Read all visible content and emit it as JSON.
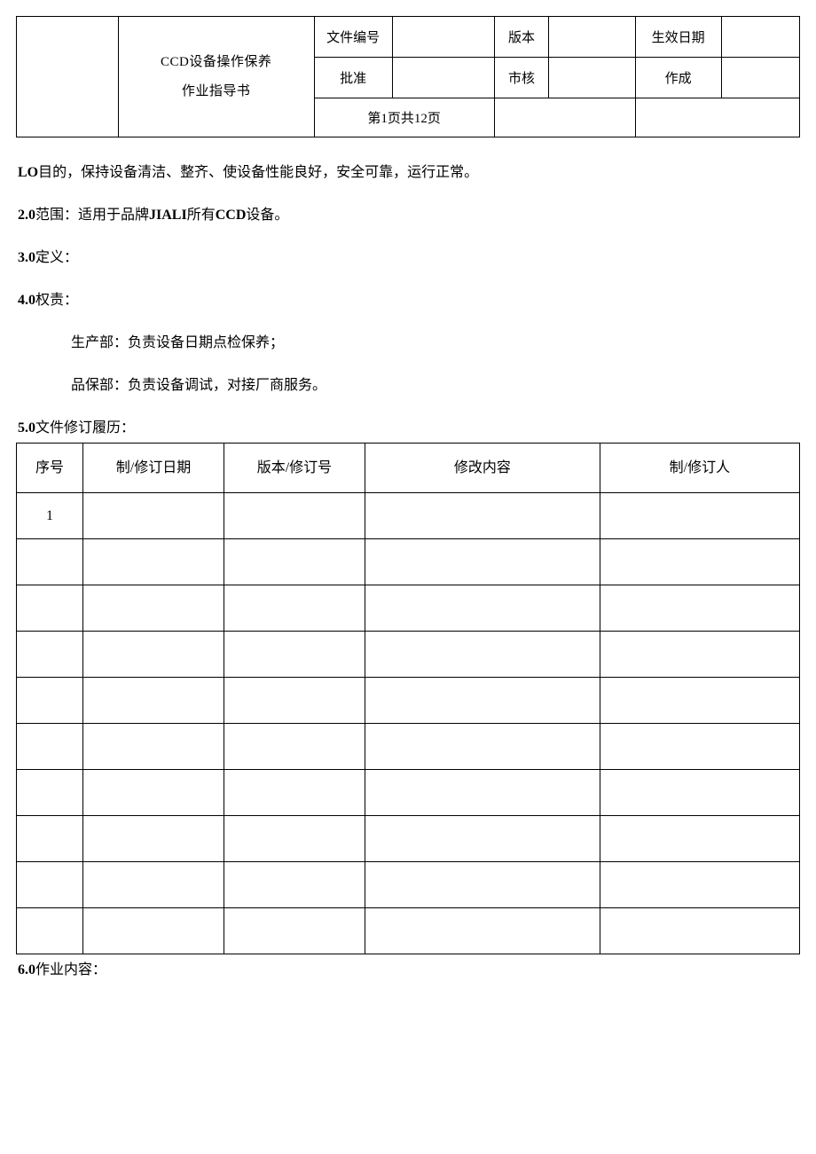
{
  "header": {
    "doc_title_line1": "CCD设备操作保养",
    "doc_title_line2": "作业指导书",
    "row1": {
      "col1_label": "文件编号",
      "col1_value": "",
      "col2_label": "版本",
      "col2_value": "",
      "col3_label": "生效日期",
      "col3_value": ""
    },
    "row2": {
      "col1_label": "批准",
      "col1_value": "",
      "col2_label": "市核",
      "col2_value": "",
      "col3_label": "作成",
      "col3_value": ""
    },
    "page_info": "第1页共12页"
  },
  "sections": {
    "s1_prefix": "LO",
    "s1_text": "目的，保持设备清洁、整齐、使设备性能良好，安全可靠，运行正常。",
    "s2_prefix": "2.0",
    "s2_text1": "范围：适用于品牌",
    "s2_bold": "JIALI",
    "s2_text2": "所有",
    "s2_bold2": "CCD",
    "s2_text3": "设备。",
    "s3_prefix": "3.0",
    "s3_text": "定义：",
    "s4_prefix": "4.0",
    "s4_text": "权责：",
    "s4_sub1": "生产部：负责设备日期点检保养；",
    "s4_sub2": "品保部：负责设备调试，对接厂商服务。",
    "s5_prefix": "5.0",
    "s5_text": "文件修订履历：",
    "s6_prefix": "6.0",
    "s6_text": "作业内容："
  },
  "revision_table": {
    "headers": {
      "seq": "序号",
      "date": "制/修订日期",
      "version": "版本/修订号",
      "content": "修改内容",
      "person": "制/修订人"
    },
    "rows": [
      {
        "seq": "1",
        "date": "",
        "version": "",
        "content": "",
        "person": ""
      },
      {
        "seq": "",
        "date": "",
        "version": "",
        "content": "",
        "person": ""
      },
      {
        "seq": "",
        "date": "",
        "version": "",
        "content": "",
        "person": ""
      },
      {
        "seq": "",
        "date": "",
        "version": "",
        "content": "",
        "person": ""
      },
      {
        "seq": "",
        "date": "",
        "version": "",
        "content": "",
        "person": ""
      },
      {
        "seq": "",
        "date": "",
        "version": "",
        "content": "",
        "person": ""
      },
      {
        "seq": "",
        "date": "",
        "version": "",
        "content": "",
        "person": ""
      },
      {
        "seq": "",
        "date": "",
        "version": "",
        "content": "",
        "person": ""
      },
      {
        "seq": "",
        "date": "",
        "version": "",
        "content": "",
        "person": ""
      },
      {
        "seq": "",
        "date": "",
        "version": "",
        "content": "",
        "person": ""
      }
    ]
  }
}
